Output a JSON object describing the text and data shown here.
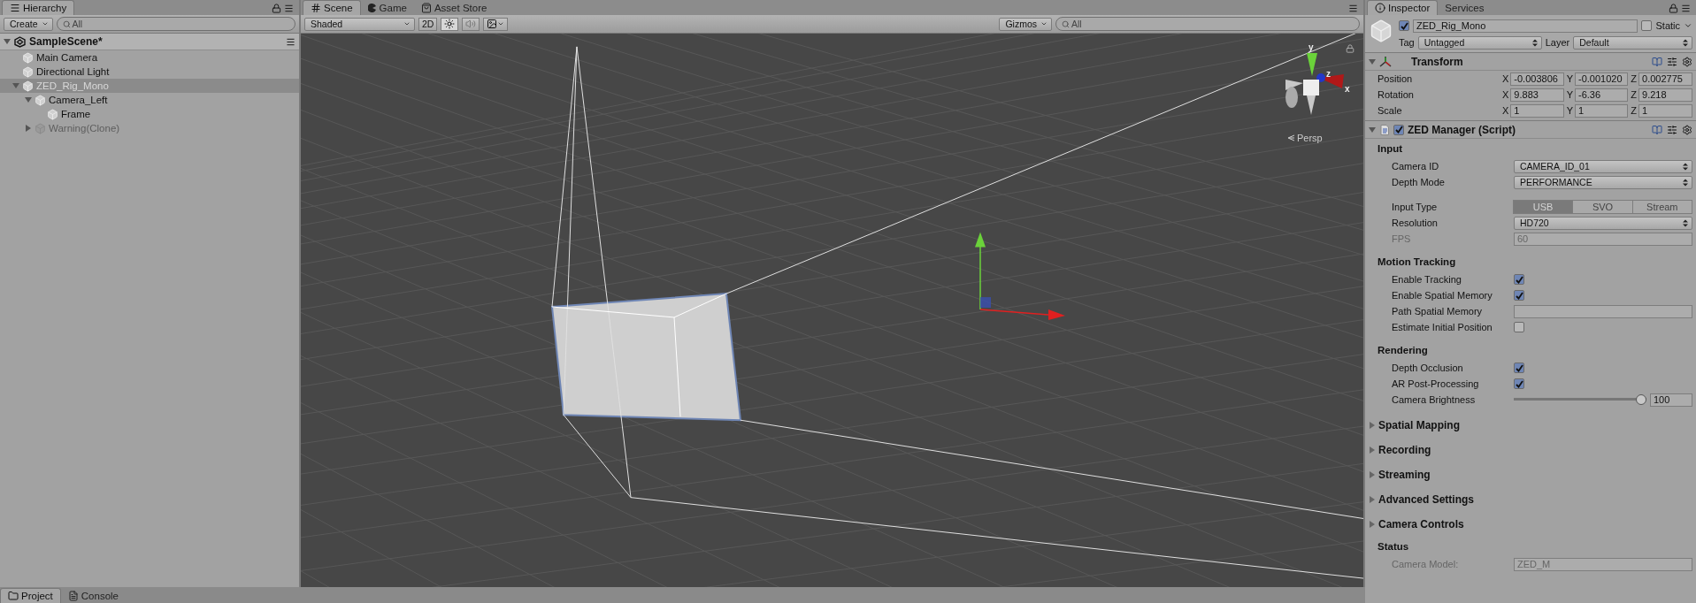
{
  "hierarchy": {
    "title": "Hierarchy",
    "create": "Create",
    "search": {
      "placeholder": "All"
    },
    "scene": "SampleScene*",
    "items": [
      {
        "name": "Main Camera",
        "selected": false,
        "disabled": false
      },
      {
        "name": "Directional Light",
        "selected": false,
        "disabled": false
      },
      {
        "name": "ZED_Rig_Mono",
        "selected": true,
        "disabled": false,
        "expanded": true,
        "children": [
          {
            "name": "Camera_Left",
            "selected": false,
            "disabled": false,
            "expanded": true,
            "children": [
              {
                "name": "Frame",
                "selected": false,
                "disabled": false
              }
            ]
          },
          {
            "name": "Warning(Clone)",
            "selected": false,
            "disabled": true,
            "expanded": false
          }
        ]
      }
    ]
  },
  "scene_view": {
    "tabs": [
      {
        "label": "Scene",
        "kind": "scene",
        "selected": true
      },
      {
        "label": "Game",
        "kind": "game",
        "selected": false
      },
      {
        "label": "Asset Store",
        "kind": "store",
        "selected": false
      }
    ],
    "shading": "Shaded",
    "mode_2d": {
      "label": "2D",
      "on": false
    },
    "toggles": [
      {
        "kind": "light",
        "on": true
      },
      {
        "kind": "audio",
        "on": false
      }
    ],
    "gizmos": "Gizmos",
    "search": {
      "placeholder": "All"
    },
    "orientation": {
      "axes": [
        "y",
        "z",
        "x"
      ],
      "projection": "Persp"
    }
  },
  "inspector": {
    "tabs": [
      {
        "label": "Inspector",
        "selected": true
      },
      {
        "label": "Services",
        "selected": false
      }
    ],
    "object": {
      "active": true,
      "name": "ZED_Rig_Mono",
      "static": false,
      "static_label": "Static",
      "tag_label": "Tag",
      "tag": "Untagged",
      "layer_label": "Layer",
      "layer": "Default"
    },
    "transform": {
      "title": "Transform",
      "expanded": true,
      "rows": [
        {
          "label": "Position",
          "fields": [
            {
              "axis": "X",
              "value": "-0.003806"
            },
            {
              "axis": "Y",
              "value": "-0.001020"
            },
            {
              "axis": "Z",
              "value": "0.002775"
            }
          ]
        },
        {
          "label": "Rotation",
          "fields": [
            {
              "axis": "X",
              "value": "9.883"
            },
            {
              "axis": "Y",
              "value": "-6.36"
            },
            {
              "axis": "Z",
              "value": "9.218"
            }
          ]
        },
        {
          "label": "Scale",
          "fields": [
            {
              "axis": "X",
              "value": "1"
            },
            {
              "axis": "Y",
              "value": "1"
            },
            {
              "axis": "Z",
              "value": "1"
            }
          ]
        }
      ]
    },
    "script": {
      "title": "ZED Manager (Script)",
      "enabled": true,
      "expanded": true,
      "sections": [
        {
          "kind": "group",
          "title": "Input",
          "rows": [
            {
              "kind": "dropdown",
              "label": "Camera ID",
              "value": "CAMERA_ID_01",
              "disabled": false
            },
            {
              "kind": "dropdown",
              "label": "Depth Mode",
              "value": "PERFORMANCE",
              "disabled": false
            },
            {
              "kind": "segmented",
              "label": "Input Type",
              "gap_before": true,
              "options": [
                {
                  "label": "USB",
                  "selected": true
                },
                {
                  "label": "SVO",
                  "selected": false
                },
                {
                  "label": "Stream",
                  "selected": false
                }
              ]
            },
            {
              "kind": "dropdown",
              "label": "Resolution",
              "value": "HD720",
              "disabled": false
            },
            {
              "kind": "field",
              "label": "FPS",
              "value": "60",
              "disabled": true
            }
          ]
        },
        {
          "kind": "group",
          "title": "Motion Tracking",
          "rows": [
            {
              "kind": "checkbox",
              "label": "Enable Tracking",
              "checked": true
            },
            {
              "kind": "checkbox",
              "label": "Enable Spatial Memory",
              "checked": true
            },
            {
              "kind": "field",
              "label": "Path Spatial Memory",
              "disabled": false
            },
            {
              "kind": "checkbox",
              "label": "Estimate Initial Position",
              "checked": false
            }
          ]
        },
        {
          "kind": "group",
          "title": "Rendering",
          "rows": [
            {
              "kind": "checkbox",
              "label": "Depth Occlusion",
              "checked": true
            },
            {
              "kind": "checkbox",
              "label": "AR Post-Processing",
              "checked": true
            },
            {
              "kind": "slider",
              "label": "Camera Brightness",
              "level": 1.0,
              "reading": "100"
            }
          ]
        },
        {
          "kind": "foldout",
          "title": "Spatial Mapping",
          "expanded": false
        },
        {
          "kind": "foldout",
          "title": "Recording",
          "expanded": false
        },
        {
          "kind": "foldout",
          "title": "Streaming",
          "expanded": false
        },
        {
          "kind": "foldout",
          "title": "Advanced Settings",
          "expanded": false
        },
        {
          "kind": "foldout",
          "title": "Camera Controls",
          "expanded": false
        },
        {
          "kind": "group",
          "title": "Status",
          "rows": [
            {
              "kind": "field",
              "label": "Camera Model:",
              "value": "ZED_M",
              "disabled": true
            }
          ]
        }
      ]
    }
  },
  "bottom_tabs": [
    {
      "label": "Project",
      "kind": "project",
      "selected": true
    },
    {
      "label": "Console",
      "kind": "console",
      "selected": false
    }
  ]
}
